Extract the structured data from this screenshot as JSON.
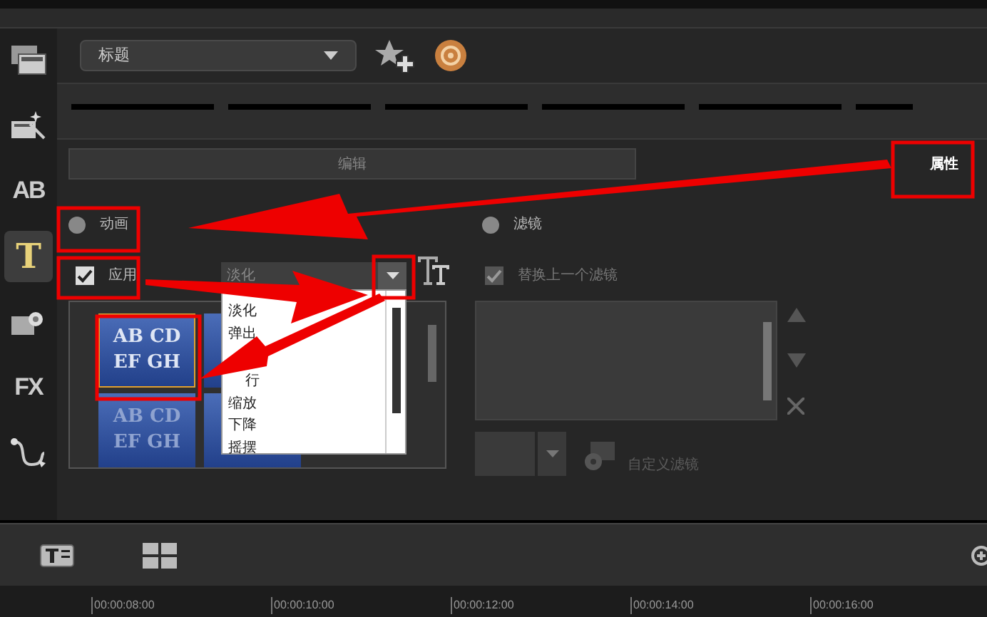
{
  "sidebar": {
    "items": [
      {
        "kind": "media",
        "selected": false
      },
      {
        "kind": "instant",
        "selected": false
      },
      {
        "kind": "text",
        "label": "AB",
        "selected": false
      },
      {
        "kind": "title",
        "label": "T",
        "selected": true
      },
      {
        "kind": "graphic",
        "selected": false
      },
      {
        "kind": "text",
        "label": "FX",
        "selected": false
      },
      {
        "kind": "path",
        "selected": false
      }
    ]
  },
  "library": {
    "dropdown_value": "标题"
  },
  "tabs": [
    {
      "label": "编辑",
      "selected": false
    },
    {
      "label": "属性",
      "selected": true
    }
  ],
  "modes": [
    {
      "label": "动画",
      "selected": false
    },
    {
      "label": "滤镜",
      "selected": false
    }
  ],
  "apply": {
    "label": "应用",
    "checked": true
  },
  "animation_dropdown": {
    "value": "淡化",
    "expanded": true,
    "options": [
      "淡化",
      "弹出",
      "行",
      "缩放",
      "下降",
      "摇摆"
    ]
  },
  "presets": [
    {
      "text": "AB CD\nEF GH",
      "selected": true
    },
    {
      "selected": false
    },
    {
      "text": "AB CD\nEF GH",
      "selected": false
    },
    {
      "selected": false
    }
  ],
  "replace_filter": {
    "label": "替换上一个滤镜",
    "checked": true
  },
  "custom_filter": {
    "label": "自定义滤镜"
  },
  "timeline": {
    "ticks": [
      "00:00:08:00",
      "00:00:10:00",
      "00:00:12:00",
      "00:00:14:00",
      "00:00:16:00"
    ]
  }
}
